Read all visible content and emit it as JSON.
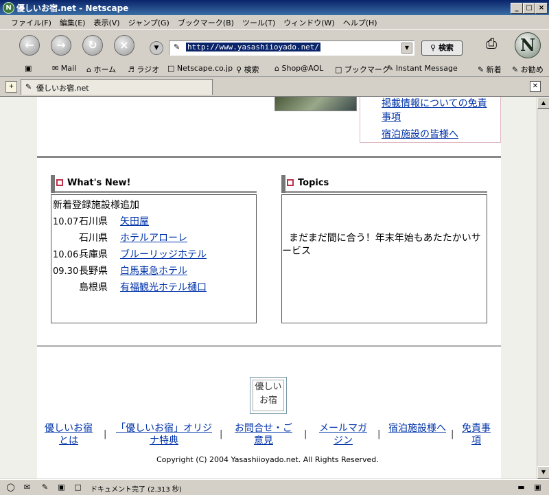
{
  "window": {
    "title": "優しいお宿.net - Netscape",
    "controls": {
      "minimize": "_",
      "maximize": "□",
      "close": "×"
    }
  },
  "menu": [
    "ファイル(F)",
    "編集(E)",
    "表示(V)",
    "ジャンプ(G)",
    "ブックマーク(B)",
    "ツール(T)",
    "ウィンドウ(W)",
    "ヘルプ(H)"
  ],
  "nav": {
    "url": "http://www.yasashiioyado.net/",
    "search_label": "検索",
    "logo": "N"
  },
  "personal_toolbar": [
    "Mail",
    "ホーム",
    "ラジオ",
    "Netscape.co.jp",
    "検索",
    "Shop@AOL",
    "ブックマーク",
    "Instant Message",
    "新着",
    "お勧め"
  ],
  "tab": {
    "title": "優しいお宿.net"
  },
  "side_links": [
    "掲載情報についての免責事項",
    "宿泊施設の皆様へ"
  ],
  "whats_new": {
    "heading": "What's New!",
    "intro": "新着登録施設様追加",
    "items": [
      {
        "date": "10.07",
        "pref": "石川県",
        "name": "矢田屋"
      },
      {
        "date": "",
        "pref": "石川県",
        "name": "ホテルアローレ"
      },
      {
        "date": "10.06",
        "pref": "兵庫県",
        "name": "ブルーリッジホテル"
      },
      {
        "date": "09.30",
        "pref": "長野県",
        "name": "白馬東急ホテル"
      },
      {
        "date": "",
        "pref": "島根県",
        "name": "有福観光ホテル樋口"
      }
    ]
  },
  "topics": {
    "heading": "Topics",
    "text": "まだまだ間に合う！年末年始もあたたかいサービス"
  },
  "footer": {
    "logo_text": "優しいお宿",
    "links": [
      "優しいお宿とは",
      "「優しいお宿」オリジナ特典",
      "お問合せ・ご意見",
      "メールマガジン",
      "宿泊施設様へ",
      "免責事項"
    ],
    "separator": "|",
    "copyright": "Copyright (C) 2004 Yasashiioyado.net. All Rights Reserved."
  },
  "status": {
    "text": "ドキュメント完了 (2.313 秒)"
  },
  "colors": {
    "link": "#0033aa",
    "accent": "#c0304a",
    "titlebar": "#0a246a"
  }
}
